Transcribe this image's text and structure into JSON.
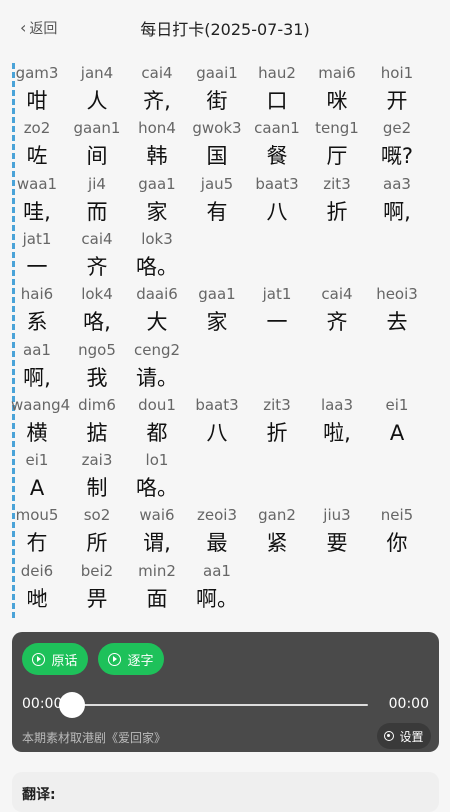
{
  "header": {
    "back_label": "返回",
    "title": "每日打卡(2025-07-31)"
  },
  "lines": [
    [
      [
        "gam3",
        "咁"
      ],
      [
        "jan4",
        "人"
      ],
      [
        "cai4",
        "齐,"
      ],
      [
        "gaai1",
        "街"
      ],
      [
        "hau2",
        "口"
      ],
      [
        "mai6",
        "咪"
      ],
      [
        "hoi1",
        "开"
      ]
    ],
    [
      [
        "zo2",
        "咗"
      ],
      [
        "gaan1",
        "间"
      ],
      [
        "hon4",
        "韩"
      ],
      [
        "gwok3",
        "国"
      ],
      [
        "caan1",
        "餐"
      ],
      [
        "teng1",
        "厅"
      ],
      [
        "ge2",
        "嘅?"
      ]
    ],
    [
      [
        "waa1",
        "哇,"
      ],
      [
        "ji4",
        "而"
      ],
      [
        "gaa1",
        "家"
      ],
      [
        "jau5",
        "有"
      ],
      [
        "baat3",
        "八"
      ],
      [
        "zit3",
        "折"
      ],
      [
        "aa3",
        "啊,"
      ]
    ],
    [
      [
        "jat1",
        "一"
      ],
      [
        "cai4",
        "齐"
      ],
      [
        "lok3",
        "咯。"
      ]
    ],
    [
      [
        "hai6",
        "系"
      ],
      [
        "lok4",
        "咯,"
      ],
      [
        "daai6",
        "大"
      ],
      [
        "gaa1",
        "家"
      ],
      [
        "jat1",
        "一"
      ],
      [
        "cai4",
        "齐"
      ],
      [
        "heoi3",
        "去"
      ]
    ],
    [
      [
        "aa1",
        "啊,"
      ],
      [
        "ngo5",
        "我"
      ],
      [
        "ceng2",
        "请。"
      ]
    ],
    [
      [
        "waang4",
        "横"
      ],
      [
        "dim6",
        "掂"
      ],
      [
        "dou1",
        "都"
      ],
      [
        "baat3",
        "八"
      ],
      [
        "zit3",
        "折"
      ],
      [
        "laa3",
        "啦,"
      ],
      [
        "ei1",
        "A"
      ]
    ],
    [
      [
        "ei1",
        "A"
      ],
      [
        "zai3",
        "制"
      ],
      [
        "lo1",
        "咯。"
      ]
    ],
    [
      [
        "mou5",
        "冇"
      ],
      [
        "so2",
        "所"
      ],
      [
        "wai6",
        "谓,"
      ],
      [
        "zeoi3",
        "最"
      ],
      [
        "gan2",
        "紧"
      ],
      [
        "jiu3",
        "要"
      ],
      [
        "nei5",
        "你"
      ]
    ],
    [
      [
        "dei6",
        "哋"
      ],
      [
        "bei2",
        "畀"
      ],
      [
        "min2",
        "面"
      ],
      [
        "aa1",
        "啊。"
      ]
    ]
  ],
  "player": {
    "btn_original": "原话",
    "btn_word": "逐字",
    "time_current": "00:00",
    "time_total": "00:00",
    "progress": 0,
    "source": "本期素材取港剧《爱回家》",
    "settings_label": "设置",
    "accent": "#1ec15a"
  },
  "translation": {
    "label": "翻译:"
  }
}
